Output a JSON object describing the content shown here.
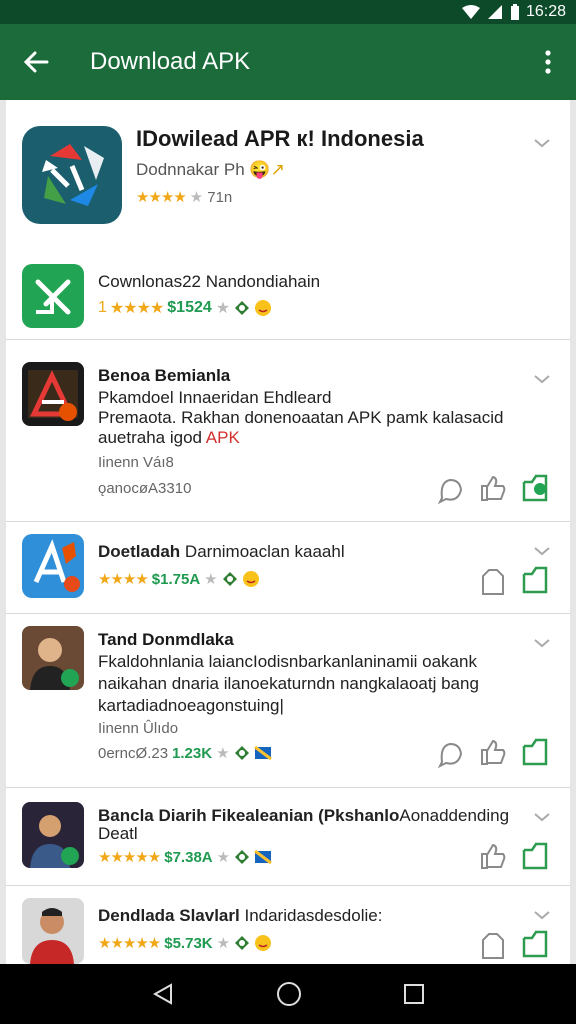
{
  "status": {
    "time": "16:28"
  },
  "appbar": {
    "title": "Download APK"
  },
  "items": [
    {
      "title": "IDowilead APR к! Indonesia",
      "subtitle": "Dodnnakar Ph",
      "subtitle_emoji": "😜↗",
      "stars": "★★★★",
      "meta": "71n"
    },
    {
      "title": "Cownlonas22 Nandondiahain",
      "prefix": "1",
      "stars": "★★★★",
      "price": "$1524"
    },
    {
      "title": "Benoa Bemianla",
      "line1": "Pkamdoel Innaeridan Ehdleard",
      "line2": "Premaota. Rakhan donenoaatan APK pamk kalasacid",
      "line3_start": "auetraha igod",
      "line3_apk": "APK",
      "meta1": "Iinenn Váı8",
      "meta2": "ǫanocøA3310"
    },
    {
      "title": "Doetladah",
      "title_rest": "Darnimoaclan kaaahl",
      "stars": "★★★★",
      "price": "$1.75A"
    },
    {
      "title": "Tand Donmdlaka",
      "line1": "Fkaldohnlania laiancIodisnbarkanlaninamii oakank",
      "line2": "naikahan dnaria ilanoekaturndn nangkalaoatj bang",
      "line3": "kartadiadnoeagonstuing|",
      "meta1": "Iinenn Ûlıdo",
      "meta2": "0erncØ.23",
      "price": "1.23K"
    },
    {
      "title": "Bancla Diarih Fikealeanian (Pkshanlo",
      "title_rest": "Aonaddending",
      "title_line2": "Deatl",
      "stars": "★★★★★",
      "price": "$7.38A"
    },
    {
      "title": "Dendlada Slavlarl",
      "title_rest": "Indaridasdesdolie:",
      "stars": "★★★★★",
      "price": "$5.73K"
    }
  ],
  "colors": {
    "appbar": "#1b6b3b",
    "statusbar": "#0d4a29",
    "accent_green": "#21a453",
    "star": "#f0a818"
  },
  "icons": [
    "back-arrow-icon",
    "more-vert-icon",
    "chevron-down-icon",
    "comment-icon",
    "thumb-up-icon",
    "share-icon",
    "nav-back-icon",
    "nav-home-icon",
    "nav-recents-icon"
  ]
}
